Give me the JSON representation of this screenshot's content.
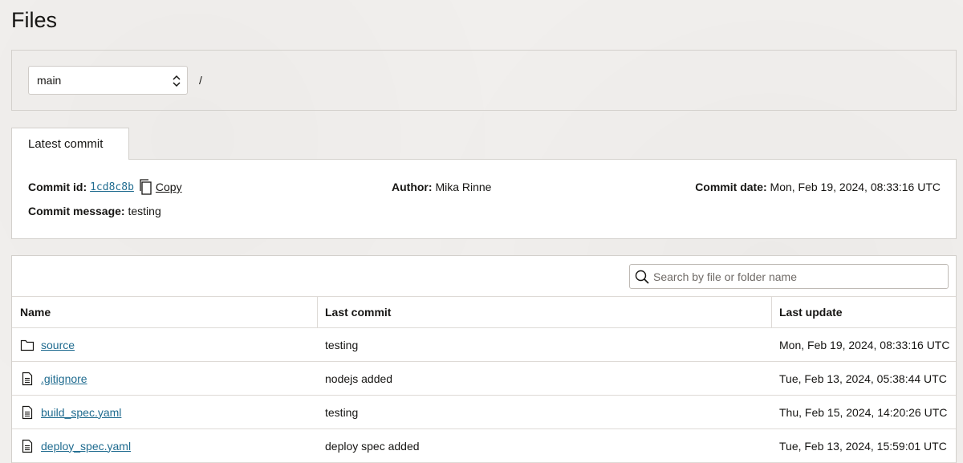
{
  "page": {
    "title": "Files"
  },
  "branch": {
    "selected": "main",
    "path": "/"
  },
  "tab": {
    "label": "Latest commit"
  },
  "commit": {
    "id_label": "Commit id:",
    "id": "1cd8c8b",
    "copy_label": "Copy",
    "author_label": "Author:",
    "author": "Mika Rinne",
    "date_label": "Commit date:",
    "date": "Mon, Feb 19, 2024, 08:33:16 UTC",
    "message_label": "Commit message:",
    "message": "testing"
  },
  "search": {
    "placeholder": "Search by file or folder name"
  },
  "table": {
    "headers": {
      "name": "Name",
      "last_commit": "Last commit",
      "last_update": "Last update"
    },
    "rows": [
      {
        "type": "folder",
        "icon": "folder-icon",
        "name": "source",
        "last_commit": "testing",
        "last_update": "Mon, Feb 19, 2024, 08:33:16 UTC"
      },
      {
        "type": "file",
        "icon": "file-icon",
        "name": ".gitignore",
        "last_commit": "nodejs added",
        "last_update": "Tue, Feb 13, 2024, 05:38:44 UTC"
      },
      {
        "type": "file",
        "icon": "file-icon",
        "name": "build_spec.yaml",
        "last_commit": "testing",
        "last_update": "Thu, Feb 15, 2024, 14:20:26 UTC"
      },
      {
        "type": "file",
        "icon": "file-icon",
        "name": "deploy_spec.yaml",
        "last_commit": "deploy spec added",
        "last_update": "Tue, Feb 13, 2024, 15:59:01 UTC"
      }
    ]
  },
  "colors": {
    "link": "#1f6b8f",
    "background": "#f1efed",
    "border": "#d3d0cc"
  }
}
